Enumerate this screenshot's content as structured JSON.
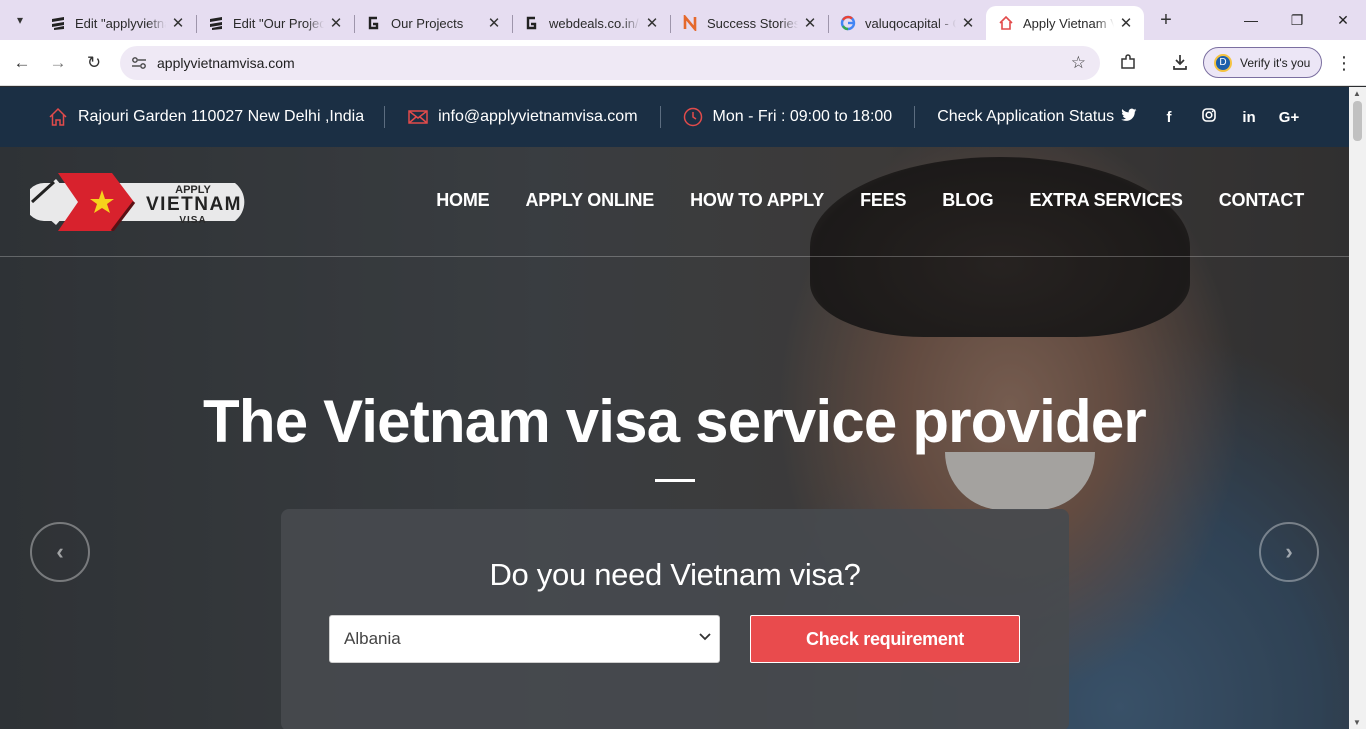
{
  "browser": {
    "tabs": [
      {
        "title": "Edit \"applyvietnamvisa\"",
        "favicon": "stack-icon",
        "active": false
      },
      {
        "title": "Edit \"Our Projects\"",
        "favicon": "stack-icon",
        "active": false
      },
      {
        "title": "Our Projects",
        "favicon": "g-icon",
        "active": false
      },
      {
        "title": "webdeals.co.in/g",
        "favicon": "g-icon",
        "active": false
      },
      {
        "title": "Success Stories -",
        "favicon": "n-icon",
        "active": false
      },
      {
        "title": "valuqocapital - G",
        "favicon": "google-icon",
        "active": false
      },
      {
        "title": "Apply Vietnam Visa",
        "favicon": "house-icon",
        "active": true
      }
    ],
    "url": "applyvietnamvisa.com",
    "profile_label": "Verify it's you",
    "profile_initial": "D"
  },
  "topbar": {
    "address": "Rajouri Garden 110027 New Delhi ,India",
    "email": "info@applyvietnamvisa.com",
    "hours": "Mon - Fri : 09:00 to 18:00",
    "status_link": "Check Application Status",
    "socials": [
      "twitter-icon",
      "facebook-icon",
      "instagram-icon",
      "linkedin-icon",
      "google-plus-icon"
    ]
  },
  "logo": {
    "line1": "APPLY",
    "line2": "VIETNAM",
    "line3": "VISA"
  },
  "nav": {
    "items": [
      "HOME",
      "APPLY ONLINE",
      "HOW TO APPLY",
      "FEES",
      "BLOG",
      "EXTRA SERVICES",
      "CONTACT"
    ]
  },
  "hero": {
    "title": "The Vietnam visa service provider",
    "question": "Do you need Vietnam visa?",
    "country_selected": "Albania",
    "button_label": "Check requirement"
  },
  "colors": {
    "topbar_bg": "#1b2f44",
    "accent_red": "#e94b4d",
    "tab_strip": "#e6ddf1"
  }
}
